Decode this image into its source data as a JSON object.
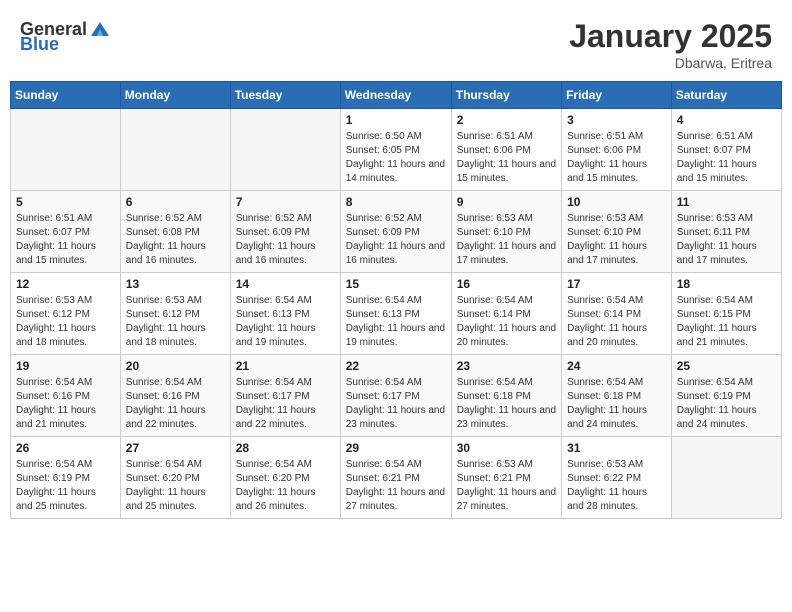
{
  "header": {
    "logo_general": "General",
    "logo_blue": "Blue",
    "month_year": "January 2025",
    "location": "Dbarwa, Eritrea"
  },
  "weekdays": [
    "Sunday",
    "Monday",
    "Tuesday",
    "Wednesday",
    "Thursday",
    "Friday",
    "Saturday"
  ],
  "weeks": [
    [
      {
        "day": "",
        "info": ""
      },
      {
        "day": "",
        "info": ""
      },
      {
        "day": "",
        "info": ""
      },
      {
        "day": "1",
        "info": "Sunrise: 6:50 AM\nSunset: 6:05 PM\nDaylight: 11 hours and 14 minutes."
      },
      {
        "day": "2",
        "info": "Sunrise: 6:51 AM\nSunset: 6:06 PM\nDaylight: 11 hours and 15 minutes."
      },
      {
        "day": "3",
        "info": "Sunrise: 6:51 AM\nSunset: 6:06 PM\nDaylight: 11 hours and 15 minutes."
      },
      {
        "day": "4",
        "info": "Sunrise: 6:51 AM\nSunset: 6:07 PM\nDaylight: 11 hours and 15 minutes."
      }
    ],
    [
      {
        "day": "5",
        "info": "Sunrise: 6:51 AM\nSunset: 6:07 PM\nDaylight: 11 hours and 15 minutes."
      },
      {
        "day": "6",
        "info": "Sunrise: 6:52 AM\nSunset: 6:08 PM\nDaylight: 11 hours and 16 minutes."
      },
      {
        "day": "7",
        "info": "Sunrise: 6:52 AM\nSunset: 6:09 PM\nDaylight: 11 hours and 16 minutes."
      },
      {
        "day": "8",
        "info": "Sunrise: 6:52 AM\nSunset: 6:09 PM\nDaylight: 11 hours and 16 minutes."
      },
      {
        "day": "9",
        "info": "Sunrise: 6:53 AM\nSunset: 6:10 PM\nDaylight: 11 hours and 17 minutes."
      },
      {
        "day": "10",
        "info": "Sunrise: 6:53 AM\nSunset: 6:10 PM\nDaylight: 11 hours and 17 minutes."
      },
      {
        "day": "11",
        "info": "Sunrise: 6:53 AM\nSunset: 6:11 PM\nDaylight: 11 hours and 17 minutes."
      }
    ],
    [
      {
        "day": "12",
        "info": "Sunrise: 6:53 AM\nSunset: 6:12 PM\nDaylight: 11 hours and 18 minutes."
      },
      {
        "day": "13",
        "info": "Sunrise: 6:53 AM\nSunset: 6:12 PM\nDaylight: 11 hours and 18 minutes."
      },
      {
        "day": "14",
        "info": "Sunrise: 6:54 AM\nSunset: 6:13 PM\nDaylight: 11 hours and 19 minutes."
      },
      {
        "day": "15",
        "info": "Sunrise: 6:54 AM\nSunset: 6:13 PM\nDaylight: 11 hours and 19 minutes."
      },
      {
        "day": "16",
        "info": "Sunrise: 6:54 AM\nSunset: 6:14 PM\nDaylight: 11 hours and 20 minutes."
      },
      {
        "day": "17",
        "info": "Sunrise: 6:54 AM\nSunset: 6:14 PM\nDaylight: 11 hours and 20 minutes."
      },
      {
        "day": "18",
        "info": "Sunrise: 6:54 AM\nSunset: 6:15 PM\nDaylight: 11 hours and 21 minutes."
      }
    ],
    [
      {
        "day": "19",
        "info": "Sunrise: 6:54 AM\nSunset: 6:16 PM\nDaylight: 11 hours and 21 minutes."
      },
      {
        "day": "20",
        "info": "Sunrise: 6:54 AM\nSunset: 6:16 PM\nDaylight: 11 hours and 22 minutes."
      },
      {
        "day": "21",
        "info": "Sunrise: 6:54 AM\nSunset: 6:17 PM\nDaylight: 11 hours and 22 minutes."
      },
      {
        "day": "22",
        "info": "Sunrise: 6:54 AM\nSunset: 6:17 PM\nDaylight: 11 hours and 23 minutes."
      },
      {
        "day": "23",
        "info": "Sunrise: 6:54 AM\nSunset: 6:18 PM\nDaylight: 11 hours and 23 minutes."
      },
      {
        "day": "24",
        "info": "Sunrise: 6:54 AM\nSunset: 6:18 PM\nDaylight: 11 hours and 24 minutes."
      },
      {
        "day": "25",
        "info": "Sunrise: 6:54 AM\nSunset: 6:19 PM\nDaylight: 11 hours and 24 minutes."
      }
    ],
    [
      {
        "day": "26",
        "info": "Sunrise: 6:54 AM\nSunset: 6:19 PM\nDaylight: 11 hours and 25 minutes."
      },
      {
        "day": "27",
        "info": "Sunrise: 6:54 AM\nSunset: 6:20 PM\nDaylight: 11 hours and 25 minutes."
      },
      {
        "day": "28",
        "info": "Sunrise: 6:54 AM\nSunset: 6:20 PM\nDaylight: 11 hours and 26 minutes."
      },
      {
        "day": "29",
        "info": "Sunrise: 6:54 AM\nSunset: 6:21 PM\nDaylight: 11 hours and 27 minutes."
      },
      {
        "day": "30",
        "info": "Sunrise: 6:53 AM\nSunset: 6:21 PM\nDaylight: 11 hours and 27 minutes."
      },
      {
        "day": "31",
        "info": "Sunrise: 6:53 AM\nSunset: 6:22 PM\nDaylight: 11 hours and 28 minutes."
      },
      {
        "day": "",
        "info": ""
      }
    ]
  ]
}
